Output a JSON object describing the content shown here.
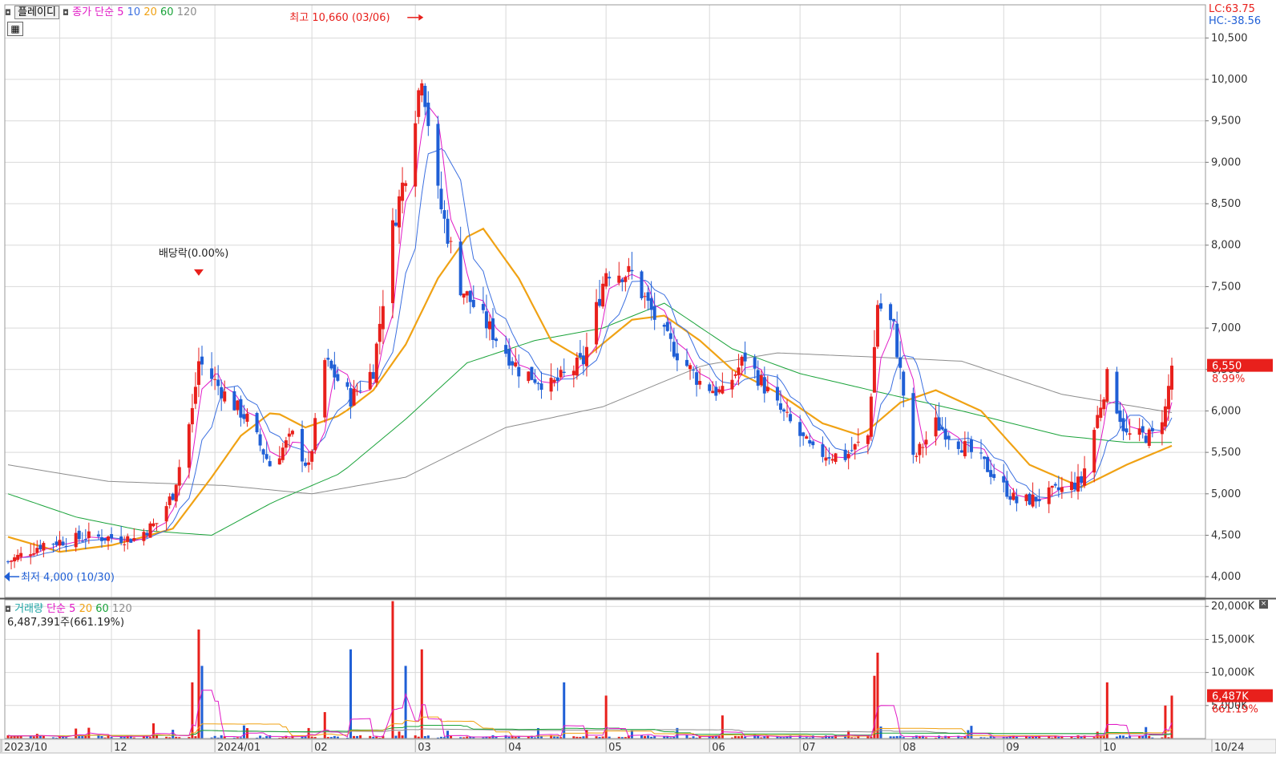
{
  "toolbar": {
    "stock_name": "플레이디",
    "price_indicator": "종가 단순",
    "ma_periods": [
      "5",
      "10",
      "20",
      "60",
      "120"
    ],
    "volume_indicator": "거래량",
    "volume_ma_label": "단순",
    "volume_ma_periods": [
      "5",
      "20",
      "60",
      "120"
    ],
    "volume_summary": "6,487,391주(661.19%)",
    "lc_readout": "LC:63.75",
    "hc_readout": "HC:-38.56"
  },
  "colors": {
    "up": "#e8201c",
    "down": "#1f5fd6",
    "ma5": "#e11ac6",
    "ma10": "#3b6fe0",
    "ma20": "#f0a214",
    "ma60": "#1aa33a",
    "ma120": "#8c8c8c",
    "grid": "#d9d9d9",
    "axis_text": "#333333"
  },
  "annotations": {
    "high": "최고 10,660 (03/06)",
    "low": "최저 4,000 (10/30)",
    "dividend": "배당락(0.00%)"
  },
  "chart_data": [
    {
      "type": "candlestick",
      "title": "플레이디",
      "x_range": [
        "2023/10",
        "10/24"
      ],
      "x_labels": [
        "2023/10",
        "12",
        "2024/01",
        "02",
        "03",
        "04",
        "05",
        "06",
        "07",
        "08",
        "09",
        "10",
        "10/24"
      ],
      "ylim": [
        3750,
        10900
      ],
      "y_ticks": [
        "4,000",
        "4,500",
        "5,000",
        "5,500",
        "6,000",
        "6,500",
        "7,000",
        "7,500",
        "8,000",
        "8,500",
        "9,000",
        "9,500",
        "10,000",
        "10,500"
      ],
      "last_price": "6,550",
      "last_change": "8.99%",
      "grid": true,
      "series": [
        {
          "name": "5",
          "role": "ma5"
        },
        {
          "name": "10",
          "role": "ma10"
        },
        {
          "name": "20",
          "role": "ma20"
        },
        {
          "name": "60",
          "role": "ma60"
        },
        {
          "name": "120",
          "role": "ma120"
        }
      ],
      "anchor_path": [
        [
          "2023-10-30",
          4180
        ],
        [
          "2023-11-10",
          4400
        ],
        [
          "2023-11-24",
          4480
        ],
        [
          "2023-12-08",
          4460
        ],
        [
          "2023-12-15",
          4650
        ],
        [
          "2023-12-20",
          5000
        ],
        [
          "2023-12-26",
          6000
        ],
        [
          "2023-12-28",
          6600
        ],
        [
          "2024-01-05",
          6200
        ],
        [
          "2024-01-12",
          5900
        ],
        [
          "2024-01-19",
          5350
        ],
        [
          "2024-01-26",
          5700
        ],
        [
          "2024-01-31",
          5300
        ],
        [
          "2024-02-05",
          6600
        ],
        [
          "2024-02-13",
          6150
        ],
        [
          "2024-02-20",
          6500
        ],
        [
          "2024-02-26",
          8200
        ],
        [
          "2024-03-01",
          8900
        ],
        [
          "2024-03-06",
          10100
        ],
        [
          "2024-03-11",
          8600
        ],
        [
          "2024-03-18",
          7500
        ],
        [
          "2024-03-25",
          7100
        ],
        [
          "2024-04-05",
          6500
        ],
        [
          "2024-04-15",
          6300
        ],
        [
          "2024-04-25",
          6600
        ],
        [
          "2024-05-02",
          7700
        ],
        [
          "2024-05-10",
          7650
        ],
        [
          "2024-05-20",
          6900
        ],
        [
          "2024-05-31",
          6350
        ],
        [
          "2024-06-07",
          6200
        ],
        [
          "2024-06-14",
          6650
        ],
        [
          "2024-06-24",
          6050
        ],
        [
          "2024-07-05",
          5500
        ],
        [
          "2024-07-15",
          5450
        ],
        [
          "2024-07-22",
          5700
        ],
        [
          "2024-07-25",
          7300
        ],
        [
          "2024-07-30",
          7000
        ],
        [
          "2024-08-05",
          5400
        ],
        [
          "2024-08-12",
          5850
        ],
        [
          "2024-08-26",
          5400
        ],
        [
          "2024-09-06",
          4900
        ],
        [
          "2024-09-13",
          4950
        ],
        [
          "2024-09-26",
          5150
        ],
        [
          "2024-10-04",
          6400
        ],
        [
          "2024-10-10",
          5700
        ],
        [
          "2024-10-18",
          5700
        ],
        [
          "2024-10-22",
          6020
        ],
        [
          "2024-10-24",
          6550
        ]
      ],
      "ma20_path": [
        [
          "2023-10-30",
          4480
        ],
        [
          "2023-11-15",
          4300
        ],
        [
          "2023-12-01",
          4380
        ],
        [
          "2023-12-10",
          4470
        ],
        [
          "2023-12-20",
          4580
        ],
        [
          "2024-01-01",
          5200
        ],
        [
          "2024-01-10",
          5700
        ],
        [
          "2024-01-20",
          6000
        ],
        [
          "2024-01-30",
          5800
        ],
        [
          "2024-02-10",
          5950
        ],
        [
          "2024-02-20",
          6250
        ],
        [
          "2024-03-01",
          6800
        ],
        [
          "2024-03-11",
          7600
        ],
        [
          "2024-03-20",
          8100
        ],
        [
          "2024-03-25",
          8200
        ],
        [
          "2024-04-05",
          7600
        ],
        [
          "2024-04-15",
          6850
        ],
        [
          "2024-04-25",
          6620
        ],
        [
          "2024-05-10",
          7100
        ],
        [
          "2024-05-20",
          7150
        ],
        [
          "2024-05-31",
          6850
        ],
        [
          "2024-06-10",
          6500
        ],
        [
          "2024-06-24",
          6220
        ],
        [
          "2024-07-08",
          5850
        ],
        [
          "2024-07-20",
          5700
        ],
        [
          "2024-08-01",
          6100
        ],
        [
          "2024-08-12",
          6250
        ],
        [
          "2024-08-26",
          6000
        ],
        [
          "2024-09-10",
          5350
        ],
        [
          "2024-09-26",
          5080
        ],
        [
          "2024-10-10",
          5350
        ],
        [
          "2024-10-24",
          5580
        ]
      ],
      "ma60_path": [
        [
          "2023-10-30",
          5000
        ],
        [
          "2023-11-20",
          4720
        ],
        [
          "2023-12-10",
          4560
        ],
        [
          "2024-01-01",
          4500
        ],
        [
          "2024-01-20",
          4900
        ],
        [
          "2024-02-10",
          5250
        ],
        [
          "2024-03-01",
          5900
        ],
        [
          "2024-03-20",
          6580
        ],
        [
          "2024-04-10",
          6850
        ],
        [
          "2024-05-01",
          7000
        ],
        [
          "2024-05-20",
          7300
        ],
        [
          "2024-06-10",
          6750
        ],
        [
          "2024-07-01",
          6450
        ],
        [
          "2024-07-24",
          6240
        ],
        [
          "2024-08-20",
          6000
        ],
        [
          "2024-09-20",
          5700
        ],
        [
          "2024-10-10",
          5620
        ],
        [
          "2024-10-24",
          5620
        ]
      ],
      "ma120_path": [
        [
          "2023-10-30",
          5350
        ],
        [
          "2023-11-30",
          5150
        ],
        [
          "2024-01-05",
          5100
        ],
        [
          "2024-02-01",
          5000
        ],
        [
          "2024-03-01",
          5200
        ],
        [
          "2024-04-01",
          5800
        ],
        [
          "2024-05-01",
          6050
        ],
        [
          "2024-06-01",
          6550
        ],
        [
          "2024-06-24",
          6700
        ],
        [
          "2024-07-24",
          6650
        ],
        [
          "2024-08-20",
          6600
        ],
        [
          "2024-09-20",
          6200
        ],
        [
          "2024-10-24",
          5980
        ]
      ]
    },
    {
      "type": "bar",
      "title": "거래량",
      "ylim": [
        0,
        21000
      ],
      "y_ticks": [
        "5,000K",
        "10,000K",
        "15,000K",
        "20,000K"
      ],
      "last_volume": "6,487K",
      "last_volume_ratio": "661.19%",
      "volume_spikes": [
        [
          "2023-12-14",
          2300
        ],
        [
          "2023-12-26",
          8500
        ],
        [
          "2023-12-28",
          16500
        ],
        [
          "2023-12-29",
          11000
        ],
        [
          "2024-02-05",
          4000
        ],
        [
          "2024-02-13",
          13500
        ],
        [
          "2024-02-26",
          20800
        ],
        [
          "2024-03-01",
          11000
        ],
        [
          "2024-03-06",
          13500
        ],
        [
          "2024-04-19",
          8500
        ],
        [
          "2024-05-02",
          6500
        ],
        [
          "2024-06-07",
          3500
        ],
        [
          "2024-07-25",
          13000
        ],
        [
          "2024-07-24",
          9500
        ],
        [
          "2024-10-04",
          8500
        ],
        [
          "2024-10-22",
          5000
        ],
        [
          "2024-10-24",
          6500
        ]
      ]
    }
  ]
}
